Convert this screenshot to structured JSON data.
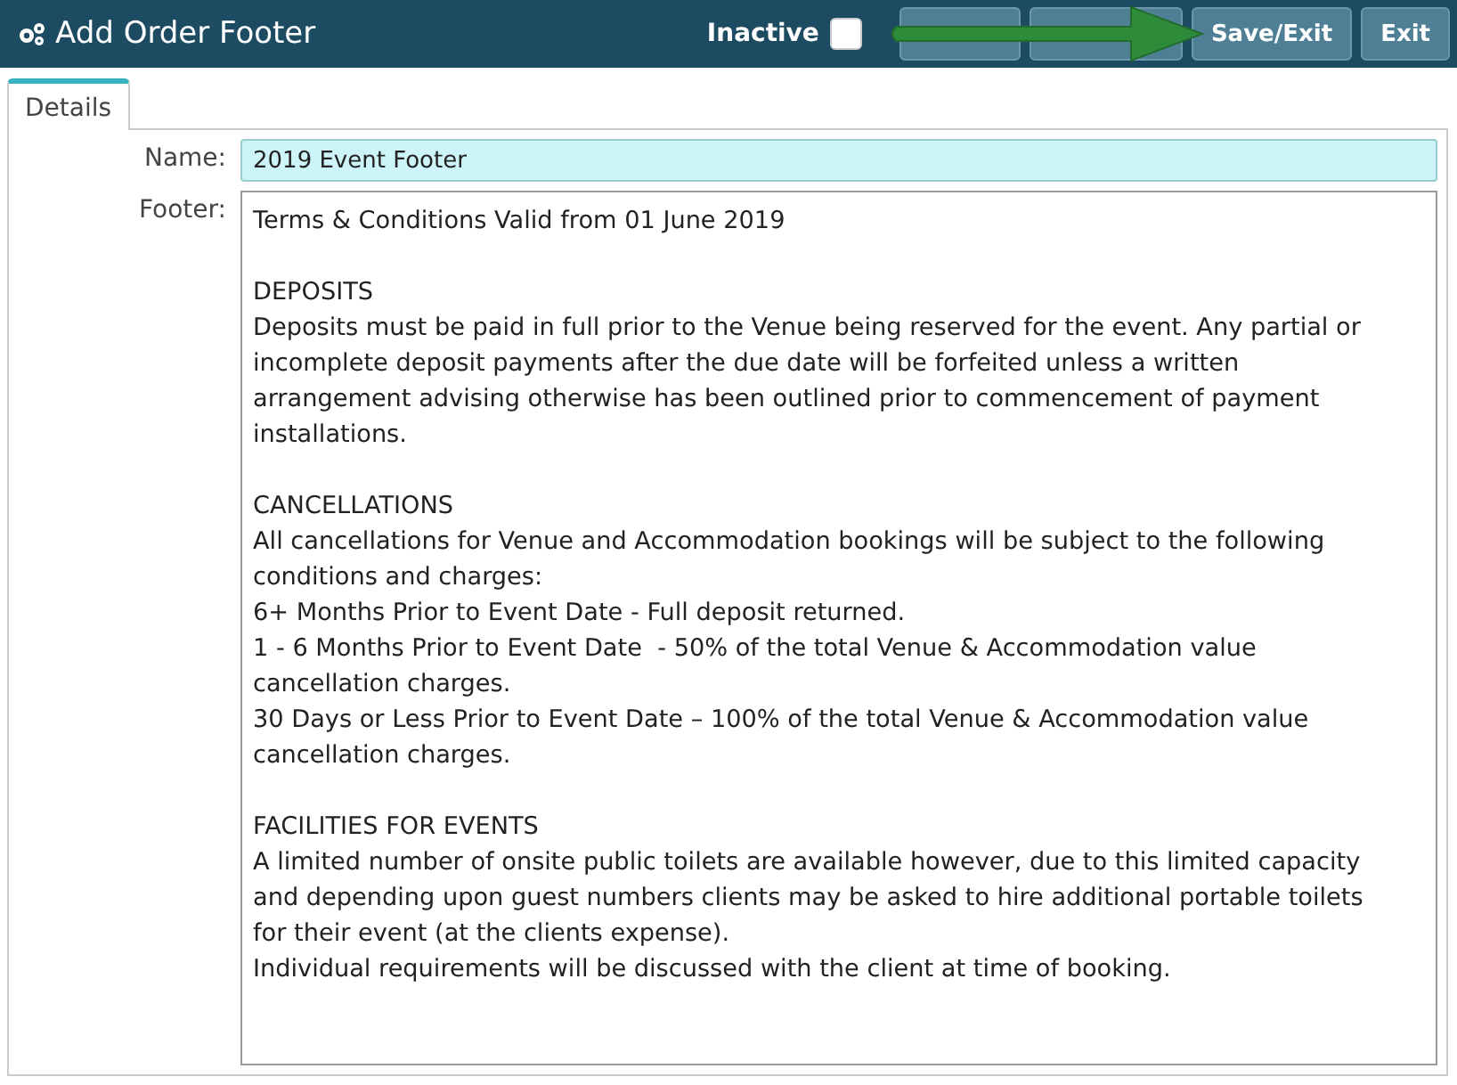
{
  "header": {
    "title": "Add Order Footer",
    "inactive": {
      "label": "Inactive",
      "checked": false
    },
    "buttons": [
      {
        "kind": "covered"
      },
      {
        "kind": "covered"
      },
      {
        "kind": "labeled",
        "label": "Save/Exit"
      },
      {
        "kind": "labeled",
        "label": "Exit"
      }
    ]
  },
  "tabs": [
    {
      "label": "Details",
      "selected": true
    }
  ],
  "form": {
    "name_label": "Name:",
    "name_value": "2019 Event Footer",
    "footer_label": "Footer:",
    "footer_paragraphs": [
      [
        "Terms & Conditions Valid from 01 June 2019"
      ],
      [
        "DEPOSITS",
        "Deposits must be paid in full prior to the Venue being reserved for the event. Any partial or",
        "incomplete deposit payments after the due date will be forfeited unless a written",
        "arrangement advising otherwise has been outlined prior to commencement of payment",
        "installations."
      ],
      [
        "CANCELLATIONS",
        "All cancellations for Venue and Accommodation bookings will be subject to the following",
        "conditions and charges:",
        "6+ Months Prior to Event Date - Full deposit returned.",
        "1 - 6 Months Prior to Event Date  - 50% of the total Venue & Accommodation value",
        "cancellation charges.",
        "30 Days or Less Prior to Event Date – 100% of the total Venue & Accommodation value",
        "cancellation charges."
      ],
      [
        "FACILITIES FOR EVENTS",
        "A limited number of onsite public toilets are available however, due to this limited capacity",
        "and depending upon guest numbers clients may be asked to hire additional portable toilets",
        "for their event (at the clients expense).",
        "Individual requirements will be discussed with the client at time of booking."
      ]
    ]
  }
}
